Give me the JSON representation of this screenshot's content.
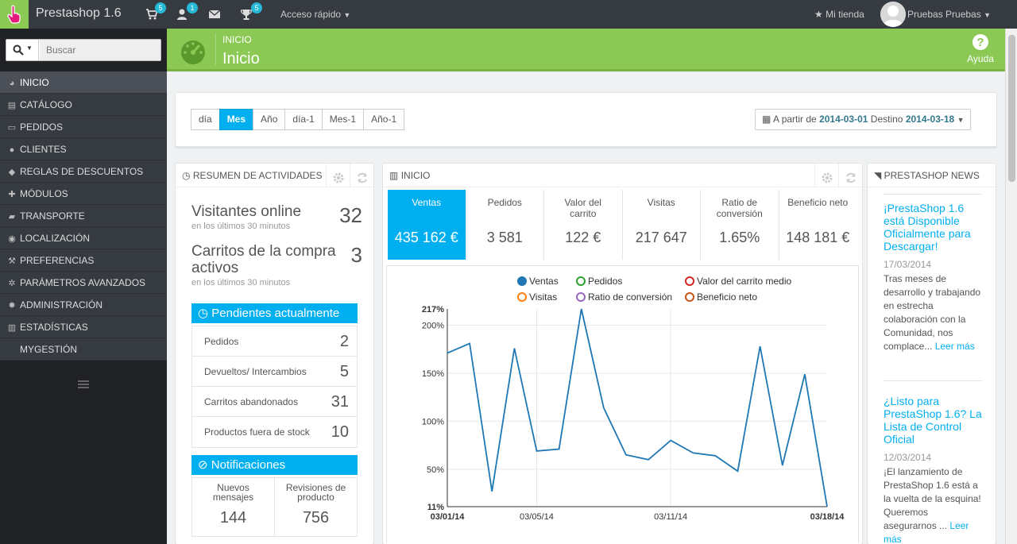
{
  "topbar": {
    "app_title": "Prestashop 1.6",
    "orders_badge": "5",
    "customers_badge": "1",
    "messages_badge": "",
    "trophy_badge": "5",
    "quick_access": "Acceso rápido",
    "my_shop": "Mi tienda",
    "user_name": "Pruebas Pruebas"
  },
  "search": {
    "placeholder": "Buscar"
  },
  "sidebar": {
    "items": [
      {
        "label": "INICIO",
        "icon": "dashboard-icon"
      },
      {
        "label": "CATÁLOGO",
        "icon": "book-icon"
      },
      {
        "label": "PEDIDOS",
        "icon": "credit-card-icon"
      },
      {
        "label": "CLIENTES",
        "icon": "users-icon"
      },
      {
        "label": "REGLAS DE DESCUENTOS",
        "icon": "tags-icon"
      },
      {
        "label": "MÓDULOS",
        "icon": "puzzle-icon"
      },
      {
        "label": "TRANSPORTE",
        "icon": "truck-icon"
      },
      {
        "label": "LOCALIZACIÓN",
        "icon": "globe-icon"
      },
      {
        "label": "PREFERENCIAS",
        "icon": "wrench-icon"
      },
      {
        "label": "PARÁMETROS AVANZADOS",
        "icon": "cogs-icon"
      },
      {
        "label": "ADMINISTRACIÓN",
        "icon": "cog-icon"
      },
      {
        "label": "ESTADÍSTICAS",
        "icon": "bar-chart-icon"
      },
      {
        "label": "MYGESTIÓN",
        "icon": ""
      }
    ]
  },
  "header": {
    "breadcrumb": "INICIO",
    "title": "Inicio",
    "help": "Ayuda"
  },
  "filters": {
    "periods": [
      "día",
      "Mes",
      "Año",
      "día-1",
      "Mes-1",
      "Año-1"
    ],
    "active_period": "Mes",
    "from_label": "A partir de",
    "from_date": "2014-03-01",
    "to_label": "Destino",
    "to_date": "2014-03-18"
  },
  "activity": {
    "title": "RESUMEN DE ACTIVIDADES",
    "online_title": "Visitantes online",
    "online_sub": "en los últimos 30 minutos",
    "online_value": "32",
    "carts_title": "Carritos de la compra activos",
    "carts_sub": "en los últimos 30 minutos",
    "carts_value": "3",
    "pending_title": "Pendientes actualmente",
    "pending": [
      {
        "label": "Pedidos",
        "value": "2"
      },
      {
        "label": "Devueltos/ Intercambios",
        "value": "5"
      },
      {
        "label": "Carritos abandonados",
        "value": "31"
      },
      {
        "label": "Productos fuera de stock",
        "value": "10"
      }
    ],
    "notifications_title": "Notificaciones",
    "notifications": [
      {
        "label": "Nuevos mensajes",
        "value": "144"
      },
      {
        "label": "Revisiones de producto",
        "value": "756"
      }
    ]
  },
  "dashboard": {
    "title": "INICIO",
    "kpis": [
      {
        "label": "Ventas",
        "value": "435 162 €"
      },
      {
        "label": "Pedidos",
        "value": "3 581"
      },
      {
        "label": "Valor del carrito",
        "value": "122 €"
      },
      {
        "label": "Visitas",
        "value": "217 647"
      },
      {
        "label": "Ratio de conversión",
        "value": "1.65%"
      },
      {
        "label": "Beneficio neto",
        "value": "148 181 €"
      }
    ]
  },
  "chart_data": {
    "type": "line",
    "legend": [
      {
        "name": "Ventas",
        "color": "#1f77b4",
        "filled": true
      },
      {
        "name": "Pedidos",
        "color": "#2ca02c",
        "filled": false
      },
      {
        "name": "Valor del carrito medio",
        "color": "#d62728",
        "filled": false
      },
      {
        "name": "Visitas",
        "color": "#ff7f0e",
        "filled": false
      },
      {
        "name": "Ratio de conversión",
        "color": "#9467bd",
        "filled": false
      },
      {
        "name": "Beneficio neto",
        "color": "#c9541a",
        "filled": false
      }
    ],
    "y_ticks": [
      "217%",
      "200%",
      "150%",
      "100%",
      "50%",
      "11%"
    ],
    "y_tick_values": [
      217,
      200,
      150,
      100,
      50,
      11
    ],
    "ylim": [
      11,
      217
    ],
    "x_ticks": [
      {
        "label": "03/01/14",
        "day": 1,
        "bold": true
      },
      {
        "label": "03/05/14",
        "day": 5,
        "bold": false
      },
      {
        "label": "03/11/14",
        "day": 11,
        "bold": false
      },
      {
        "label": "03/18/14",
        "day": 18,
        "bold": true
      }
    ],
    "xlim": [
      1,
      18
    ],
    "series": [
      {
        "name": "Ventas",
        "color": "#1f77b4",
        "x": [
          "03/01/14",
          "03/02/14",
          "03/03/14",
          "03/04/14",
          "03/05/14",
          "03/06/14",
          "03/07/14",
          "03/08/14",
          "03/09/14",
          "03/10/14",
          "03/11/14",
          "03/12/14",
          "03/13/14",
          "03/14/14",
          "03/15/14",
          "03/16/14",
          "03/17/14",
          "03/18/14"
        ],
        "values": [
          171,
          181,
          27,
          176,
          69,
          71,
          217,
          114,
          65,
          60,
          80,
          67,
          64,
          48,
          178,
          54,
          149,
          11
        ]
      }
    ]
  },
  "news": {
    "title": "PRESTASHOP NEWS",
    "items": [
      {
        "title": "¡PrestaShop 1.6 está Disponible Oficialmente para Descargar!",
        "date": "17/03/2014",
        "body": "Tras meses de desarrollo y trabajando en estrecha colaboración con la Comunidad, nos complace...",
        "more": "Leer más"
      },
      {
        "title": "¿Listo para PrestaShop 1.6? La Lista de Control Oficial",
        "date": "12/03/2014",
        "body": "¡El lanzamiento de PrestaShop 1.6 está a la vuelta de la esquina! Queremos asegurarnos ...",
        "more": "Leer más"
      }
    ]
  }
}
